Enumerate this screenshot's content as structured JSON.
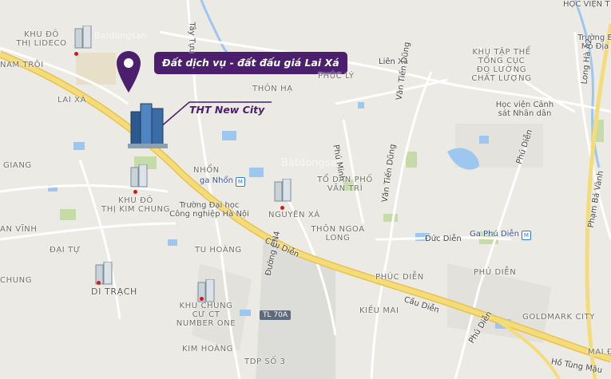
{
  "callout": {
    "title": "Đất dịch vụ - đất đấu giá Lai Xá"
  },
  "project": {
    "name": "THT New City"
  },
  "areas": {
    "khu_do_thi_lideco": "KHU ĐÔ\nTHỊ LIDECO",
    "nam_troi": "NAM TRÕI",
    "lai_xa": "LAI XÁ",
    "tay_tuu": "Tây Tựu",
    "thon_ha": "THÔN HẠ",
    "phuc_lu": "PHÚC LÝ",
    "lien_xa": "Liên Xã",
    "khu_tap_the": "KHU TẬP THỂ\nTỔNG CỤC\nĐO LƯỜNG\nCHẤT LƯỢNG",
    "hoc_vien": "HỌC VIỆN T",
    "truong_e": "Trường E\nMỏ Địa",
    "hoc_vien_canh_sat": "Học viện Cảnh\nsát Nhân dân",
    "giang": "GIANG",
    "nhon": "NHỔN",
    "khu_do_thi_kim_chung": "KHU ĐÔ\nTHỊ KIM CHUNG",
    "truong_dai_hoc": "Trường Đại học\nCông nghiệp Hà Nội",
    "nguyen_xa": "NGUYÊN XÁ",
    "to_dan_pho_van_tri": "TỔ DÂN PHỐ\nVĂN TRÌ",
    "thon_ngoa_long": "THÔN NGOA\nLONG",
    "an_vinh": "AN VĨNH",
    "dai_tu": "ĐẠI TỰ",
    "tu_hoang": "TU HOÀNG",
    "chung": "CHUNG",
    "di_trach": "DI TRẠCH",
    "khu_chung_cu": "KHU CHUNG\nCƯ CT\nNUMBER ONE",
    "kim_hoang": "KIM HOÀNG",
    "tdp_so_3": "TDP SỐ 3",
    "phuc_dien": "PHÚC DIỄN",
    "kieu_mai": "KIỀU MAI",
    "phu_dien": "PHÚ DIỄN",
    "goldmark_city": "GOLDMARK CITY",
    "mai_dich": "MAI Đ",
    "duc_dien": "Đức Diễn"
  },
  "roads": {
    "cau_dien_1": "Cầu Diễn",
    "cau_dien_2": "Cầu Diễn",
    "phu_minh": "Phú Minh",
    "van_tien_dung_1": "Văn Tiến Dũng",
    "van_tien_dung_2": "Văn Tiến Dũng",
    "phu_dien_road": "Phú Diễn",
    "phu_dien_road_2": "Phú Diễn",
    "duong_cn4": "Đường CN4",
    "lang_ha_a2": "Long Hà A2",
    "phan_ba_vanh": "Phạm Bá Vành",
    "ho_tung_mau": "Hồ Tùng Mậu",
    "tl70a": "TL 70A"
  },
  "stations": {
    "ga_nhon": "ga Nhổn",
    "ga_phu_dien": "Ga Phú Diễn"
  },
  "watermark": {
    "text": "Batdongsan"
  },
  "colors": {
    "callout_bg": "#4b1f6e",
    "pin": "#4b1f6e",
    "main_road": "#f2d35a",
    "dot": "#d8161b"
  }
}
